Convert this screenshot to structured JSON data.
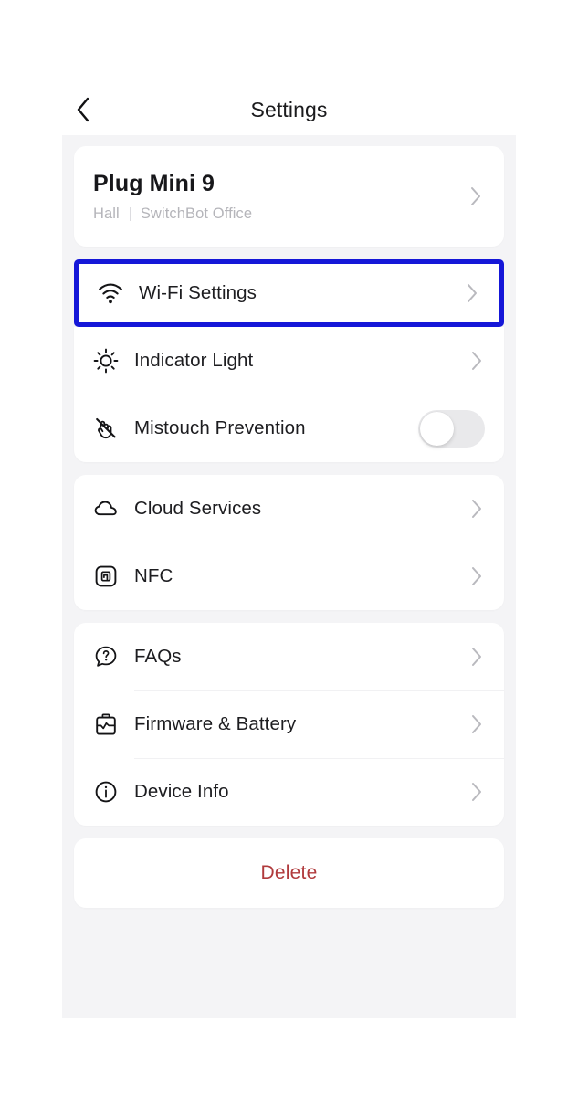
{
  "header": {
    "title": "Settings",
    "back_icon": "chevron-left-icon"
  },
  "device": {
    "name": "Plug Mini 9",
    "room": "Hall",
    "home": "SwitchBot Office",
    "chevron": "chevron-right-icon"
  },
  "groups": [
    {
      "rows": [
        {
          "label": "Wi-Fi Settings",
          "icon": "wifi-icon",
          "accessory": "chevron",
          "highlighted": true
        },
        {
          "label": "Indicator Light",
          "icon": "sun-icon",
          "accessory": "chevron",
          "highlighted": false
        },
        {
          "label": "Mistouch Prevention",
          "icon": "hand-slash-icon",
          "accessory": "toggle",
          "toggle_on": false,
          "highlighted": false
        }
      ]
    },
    {
      "rows": [
        {
          "label": "Cloud Services",
          "icon": "cloud-icon",
          "accessory": "chevron",
          "highlighted": false
        },
        {
          "label": "NFC",
          "icon": "nfc-icon",
          "accessory": "chevron",
          "highlighted": false
        }
      ]
    },
    {
      "rows": [
        {
          "label": "FAQs",
          "icon": "question-bubble-icon",
          "accessory": "chevron",
          "highlighted": false
        },
        {
          "label": "Firmware & Battery",
          "icon": "battery-icon",
          "accessory": "chevron",
          "highlighted": false
        },
        {
          "label": "Device Info",
          "icon": "info-circle-icon",
          "accessory": "chevron",
          "highlighted": false
        }
      ]
    }
  ],
  "delete": {
    "label": "Delete"
  },
  "colors": {
    "highlight_border": "#1517d8",
    "delete_text": "#b03a3c",
    "panel_background": "#f4f4f6",
    "card_background": "#ffffff",
    "toggle_track_off": "#e9e9eb",
    "secondary_text": "#b5b5ba"
  }
}
